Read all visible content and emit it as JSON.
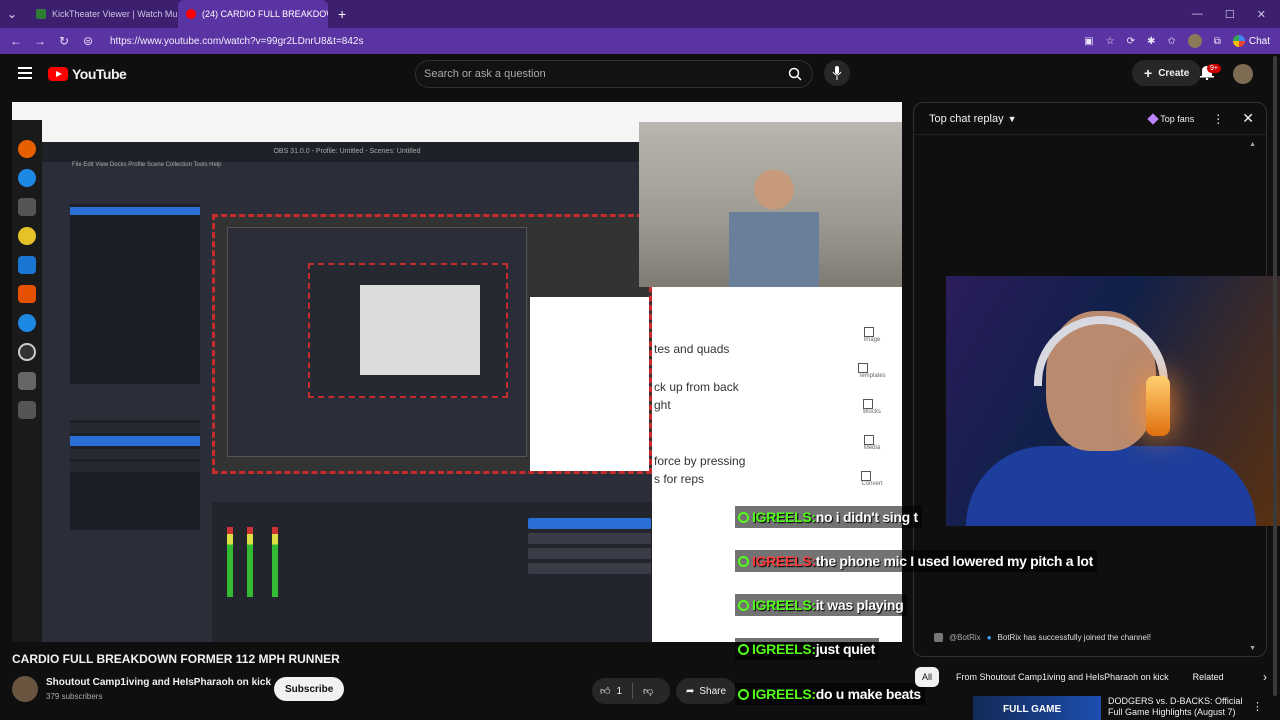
{
  "browser": {
    "tabs": [
      {
        "title": "KickTheater Viewer | Watch Multi",
        "active": false,
        "color": "#2e7d32"
      },
      {
        "title": "(24) CARDIO FULL BREAKDOWN FC",
        "active": true,
        "color": "#ff0000"
      }
    ],
    "url": "https://www.youtube.com/watch?v=99gr2LDnrU8&t=842s",
    "chat_button": "Chat"
  },
  "header": {
    "logo_text": "YouTube",
    "search_placeholder": "Search or ask a question",
    "create_label": "Create",
    "notif_badge": "9+"
  },
  "video_content": {
    "doc_lines": [
      "tes and quads",
      "ck up from back",
      "ght",
      "force by pressing",
      "s for reps"
    ],
    "doc_side": [
      "Image",
      "Templates",
      "Blocks",
      "Media",
      "Convert"
    ],
    "obs_title": "OBS 31.0.0 - Profile: Untitled - Scenes: Untitled"
  },
  "overlay_chat": [
    {
      "user": "IGREELS:",
      "user_color": "green",
      "text": "no i didn't sing t"
    },
    {
      "user": "IGREELS:",
      "user_color": "red",
      "text": "the phone mic I used lowered my pitch a lot"
    },
    {
      "user": "IGREELS:",
      "user_color": "green",
      "text": "it was playing"
    },
    {
      "user": "IGREELS:",
      "user_color": "green",
      "text": "just quiet"
    },
    {
      "user": "IGREELS:",
      "user_color": "green",
      "text": "do u make beats"
    }
  ],
  "chat_panel": {
    "title": "Top chat replay",
    "top_fans": "Top fans",
    "bot_name": "@BotRix",
    "bot_message": "BotRix has successfully joined the channel!"
  },
  "video_info": {
    "title": "CARDIO FULL BREAKDOWN FORMER 112 MPH RUNNER",
    "channel": "Shoutout Camp1iving and HeIsPharaoh on kick",
    "subscribers": "379 subscribers",
    "subscribe_label": "Subscribe",
    "likes": "1",
    "share_label": "Share"
  },
  "chips": [
    "All",
    "From Shoutout Camp1iving and HeIsPharaoh on kick",
    "Related"
  ],
  "related": {
    "thumb_text": "FULL GAME",
    "title": "DODGERS vs. D-BACKS: Official Full Game Highlights (August 7)"
  },
  "colors": {
    "browser_frame": "#5b34a3",
    "kick_green": "#53fc18",
    "yt_red": "#ff0000"
  }
}
